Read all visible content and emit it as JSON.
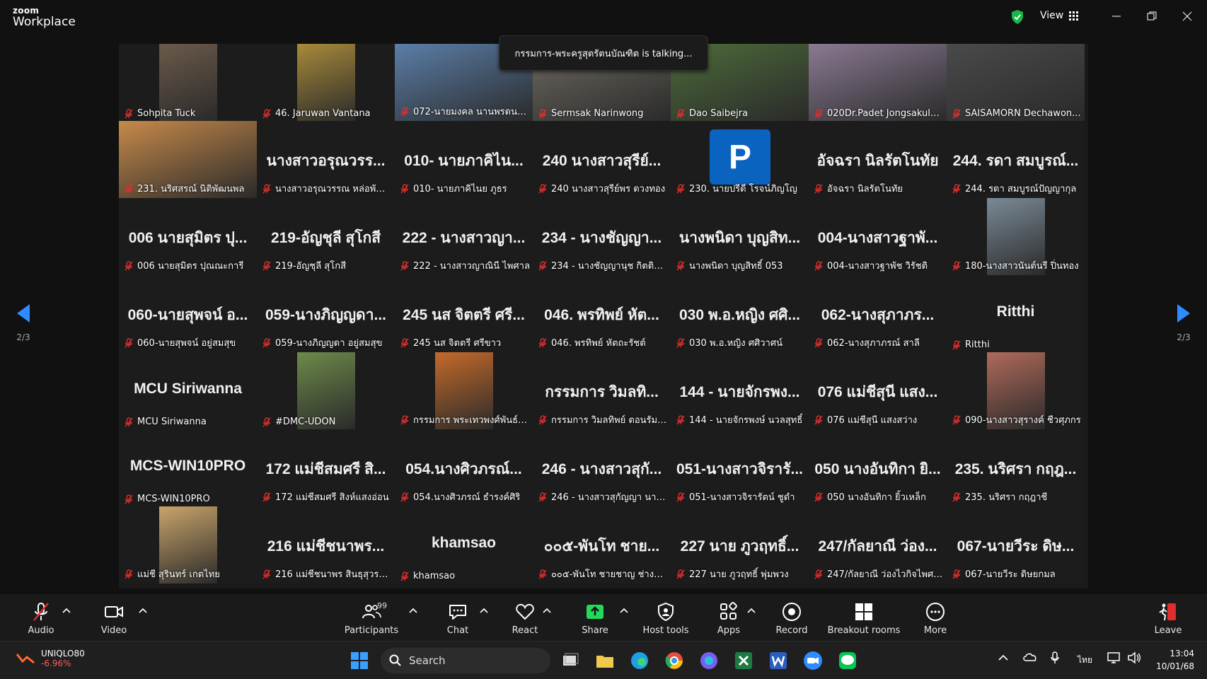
{
  "app": {
    "brand_small": "zoom",
    "brand_large": "Workplace",
    "view_label": "View"
  },
  "talking_banner": "กรรมการ-พระครูสุตรัตนบัณฑิต is talking...",
  "pager": {
    "left": "2/3",
    "right": "2/3"
  },
  "tiles": [
    {
      "label": "Sohpita Tuck",
      "kind": "video",
      "color": "#6b5a4a"
    },
    {
      "label": "46. Jaruwan Vantana",
      "kind": "video",
      "color": "#a88a3a"
    },
    {
      "label": "072-นายมงคล นานพรดนสกุล",
      "kind": "videofull",
      "color": "#5b7ea8"
    },
    {
      "label": "Sermsak Narinwong",
      "kind": "videofull",
      "color": "#6e6a60"
    },
    {
      "label": "Dao Saibejra",
      "kind": "videofull",
      "color": "#4d6b3a"
    },
    {
      "label": "020Dr.Padet Jongsakulsiri",
      "kind": "videofull",
      "color": "#8a7a92"
    },
    {
      "label": "SAISAMORN  Dechawon...",
      "kind": "videofull",
      "color": "#4a4a4a"
    },
    {
      "label": "231. นริศสรณ์ นิติพัฒนพล",
      "kind": "videofull",
      "color": "#c78a4a"
    },
    {
      "label": "นางสาวอรุณวรรณ หล่อพัฒน...",
      "big": "นางสาวอรุณวรร...",
      "kind": "text"
    },
    {
      "label": "010- นายภาคิไนย ภูธร",
      "big": "010- นายภาคิไน...",
      "kind": "text"
    },
    {
      "label": "240 นางสาวสุรีย์พร ดวงทอง",
      "big": "240 นางสาวสุรีย์...",
      "kind": "text"
    },
    {
      "label": "230. นายปรีดี โรจน์ภิญโญ",
      "avatar": "P",
      "kind": "avatar"
    },
    {
      "label": "อัจฉรา นิลรัตโนทัย",
      "big": "อัจฉรา นิลรัตโนทัย",
      "kind": "text"
    },
    {
      "label": "244. รดา สมบูรณ์ปัญญากุล",
      "big": "244. รดา สมบูรณ์...",
      "kind": "text"
    },
    {
      "label": "006 นายสุมิตร ปุณณะการี",
      "big": "006 นายสุมิตร ปุ...",
      "kind": "text"
    },
    {
      "label": "219-อัญชุลี สุโกสี",
      "big": "219-อัญชุลี สุโกสี",
      "kind": "text"
    },
    {
      "label": "222 - นางสาวญาณินี  ไพศาล",
      "big": "222 - นางสาวญา...",
      "kind": "text"
    },
    {
      "label": "234 - นางชัญญานุช กิตติภา...",
      "big": "234 - นางชัญญา...",
      "kind": "text"
    },
    {
      "label": "นางพนิดา บุญสิทธิ์ 053",
      "big": "นางพนิดา บุญสิท...",
      "kind": "text"
    },
    {
      "label": "004-นางสาวฐาพัช  วิรัชติ",
      "big": "004-นางสาวฐาพั...",
      "kind": "text"
    },
    {
      "label": "180-นางสาวนันต์นรี ปิ่นทอง",
      "kind": "video",
      "color": "#7a8a96"
    },
    {
      "label": "060-นายสุพจน์ อยู่สมสุข",
      "big": "060-นายสุพจน์ อ...",
      "kind": "text"
    },
    {
      "label": "059-นางภิญญดา อยู่สมสุข",
      "big": "059-นางภิญญดา...",
      "kind": "text"
    },
    {
      "label": "245 นส จิตตรี ศรีขาว",
      "big": "245 นส จิตตรี ศรี...",
      "kind": "text"
    },
    {
      "label": "046. พรทิพย์ หัตถะรัชต์",
      "big": "046. พรทิพย์ หัต...",
      "kind": "text"
    },
    {
      "label": "030 พ.อ.หญิง ศศิวาศน์",
      "big": "030 พ.อ.หญิง ศศิ...",
      "kind": "text"
    },
    {
      "label": "062-นางสุภาภรณ์  สาลี",
      "big": "062-นางสุภาภร...",
      "kind": "text"
    },
    {
      "label": "Ritthi",
      "big": "Ritthi",
      "kind": "text"
    },
    {
      "label": "MCU Siriwanna",
      "big": "MCU Siriwanna",
      "kind": "text"
    },
    {
      "label": "#DMC-UDON",
      "kind": "video",
      "color": "#6d8a4a"
    },
    {
      "label": "กรรมการ พระเทวพงศ์พันธ์ ต...",
      "kind": "video",
      "color": "#c46a2a"
    },
    {
      "label": "กรรมการ  วิมลทิพย์  ตอนรัมย์ ...",
      "big": "กรรมการ  วิมลทิ...",
      "kind": "text"
    },
    {
      "label": "144 - นายจักรพงษ์ นวลสุทธิ์",
      "big": "144 - นายจักรพง...",
      "kind": "text"
    },
    {
      "label": "076 แม่ชีสุนี  แสงสว่าง",
      "big": "076 แม่ชีสุนี  แสง...",
      "kind": "text"
    },
    {
      "label": "090-นางสาวสุรางค์ ชีวศุภกร",
      "kind": "video",
      "color": "#b06a5a"
    },
    {
      "label": "MCS-WIN10PRO",
      "big": "MCS-WIN10PRO",
      "kind": "text"
    },
    {
      "label": "172 แม่ชีสมศรี สิงห์แสงอ่อน",
      "big": "172 แม่ชีสมศรี สิ...",
      "kind": "text"
    },
    {
      "label": "054.นางศิวภรณ์ ธำรงค์ศิริ",
      "big": "054.นางศิวภรณ์...",
      "kind": "text"
    },
    {
      "label": "246 - นางสาวสุกัญญา  นาท...",
      "big": "246 - นางสาวสุกั...",
      "kind": "text"
    },
    {
      "label": "051-นางสาวจิรารัตน์ ชูดำ",
      "big": "051-นางสาวจิรารั...",
      "kind": "text"
    },
    {
      "label": "050 นางอันทิกา ยิ้วเหล็ก",
      "big": "050 นางอันทิกา ยิ...",
      "kind": "text"
    },
    {
      "label": "235. นริศรา กฤฎาชี",
      "big": "235. นริศรา กฤฎ...",
      "kind": "text"
    },
    {
      "label": "แม่ชี สุรินทร์ เกตไทย",
      "kind": "video",
      "color": "#c9a46a"
    },
    {
      "label": "216 แม่ชีชนาพร สินธุสุวรรณ",
      "big": "216 แม่ชีชนาพร...",
      "kind": "text"
    },
    {
      "label": "khamsao",
      "big": "khamsao",
      "kind": "text"
    },
    {
      "label": "๐๐๕-พันโท ชายชาญ  ช่างสุ...",
      "big": "๐๐๕-พันโท ชาย...",
      "kind": "text"
    },
    {
      "label": "227 นาย ภูวฤทธิ์ พุ่มพวง",
      "big": "227 นาย ภูวฤทธิ์...",
      "kind": "text"
    },
    {
      "label": "247/กัลยาณี ว่องไวกิจไพศาล",
      "big": "247/กัลยาณี ว่อง...",
      "kind": "text"
    },
    {
      "label": "067-นายวีระ ดิษยกมล",
      "big": "067-นายวีระ ดิษ...",
      "kind": "text"
    }
  ],
  "toolbar": {
    "audio": "Audio",
    "video": "Video",
    "participants": "Participants",
    "participants_count": "99",
    "chat": "Chat",
    "react": "React",
    "share": "Share",
    "host_tools": "Host tools",
    "apps": "Apps",
    "record": "Record",
    "breakout": "Breakout rooms",
    "more": "More",
    "leave": "Leave"
  },
  "taskbar": {
    "stock_name": "UNIQLO80",
    "stock_change": "-6.96%",
    "search_placeholder": "Search",
    "lang": "ไทย",
    "time": "13:04",
    "date": "10/01/68"
  },
  "colors": {
    "accent_blue": "#2d8cff",
    "mic_red": "#e02e2e",
    "share_green": "#23d959",
    "shield_green": "#1bb64a"
  }
}
